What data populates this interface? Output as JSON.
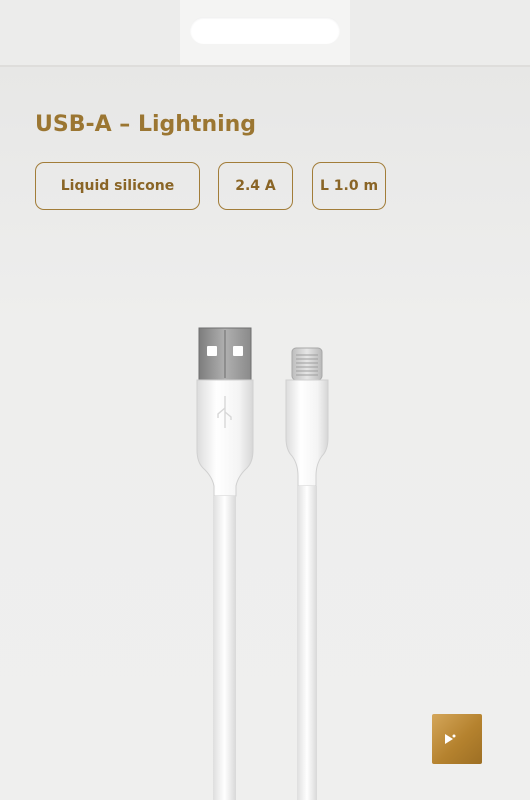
{
  "product": {
    "title": "USB-A – Lightning"
  },
  "features": [
    "Liquid silicone",
    "2.4 A",
    "L 1.0 m"
  ],
  "colors": {
    "accent": "#9b7632",
    "badge_border": "#a27d39",
    "background": "#ececeb",
    "cable": "#ffffff",
    "logo_gold": "#c4923f"
  },
  "icons": {
    "brand": "crescent-fish-logo-icon",
    "usb": "usb-trident-icon"
  }
}
